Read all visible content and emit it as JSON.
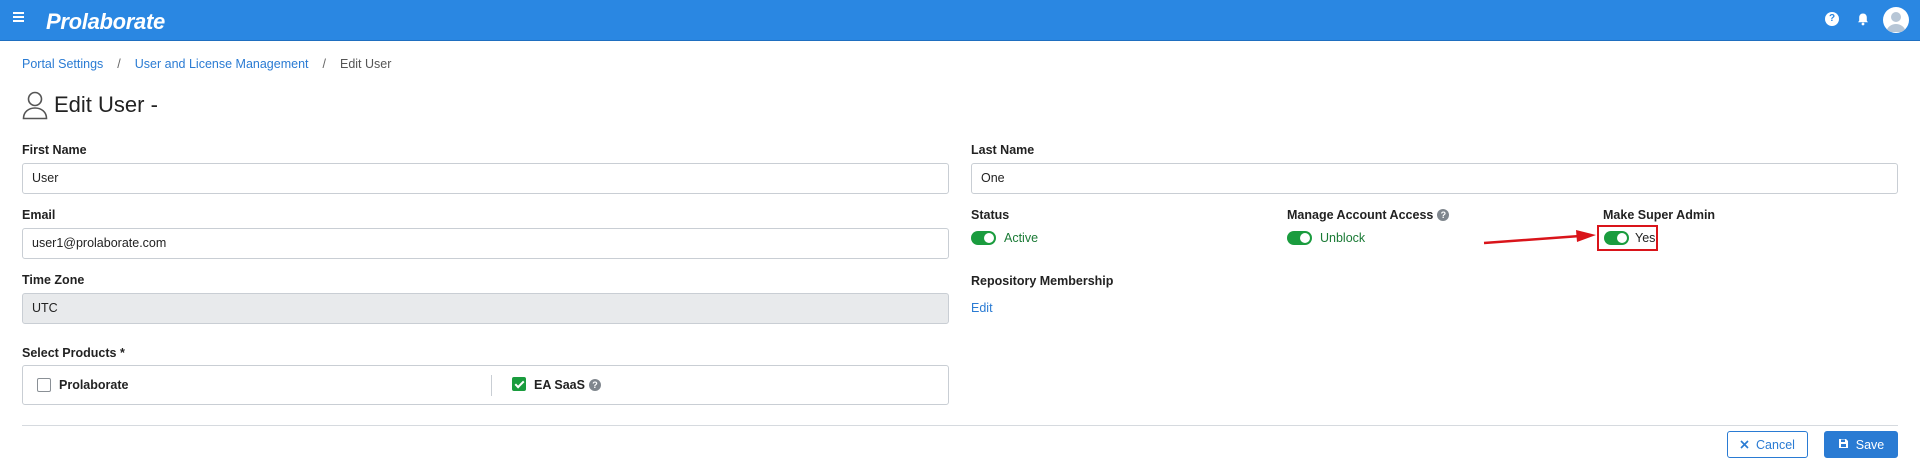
{
  "app": {
    "name": "Prolaborate"
  },
  "topbar": {
    "help_icon": "question-circle-icon",
    "bell_icon": "bell-icon",
    "avatar_icon": "user-avatar-icon"
  },
  "breadcrumb": {
    "items": [
      "Portal Settings",
      "User and License Management",
      "Edit User"
    ],
    "separator": "/"
  },
  "page": {
    "title": "Edit User -"
  },
  "form": {
    "first_name": {
      "label": "First Name",
      "value": "User"
    },
    "last_name": {
      "label": "Last Name",
      "value": "One"
    },
    "email": {
      "label": "Email",
      "value": "user1@prolaborate.com"
    },
    "time_zone": {
      "label": "Time Zone",
      "value": "UTC"
    },
    "status": {
      "label": "Status",
      "value": "Active",
      "on": true
    },
    "manage_account_access": {
      "label": "Manage Account Access",
      "value": "Unblock",
      "on": true
    },
    "super_admin": {
      "label": "Make Super Admin",
      "value": "Yes",
      "on": true
    },
    "repository_membership": {
      "label": "Repository Membership",
      "link": "Edit"
    },
    "products": {
      "label": "Select Products *",
      "options": [
        {
          "name": "Prolaborate",
          "checked": false
        },
        {
          "name": "EA SaaS",
          "checked": true
        }
      ]
    }
  },
  "actions": {
    "cancel": "Cancel",
    "save": "Save"
  },
  "colors": {
    "brand": "#2a87e2",
    "toggle_on": "#1a9c3e",
    "link": "#2a7bd3",
    "annotation": "#d9141a"
  }
}
